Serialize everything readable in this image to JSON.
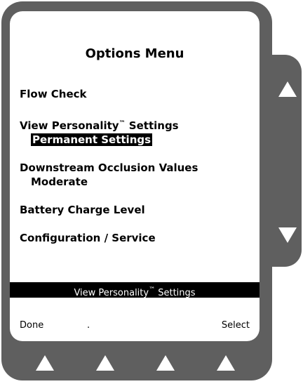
{
  "screen": {
    "title": "Options Menu",
    "menu": [
      {
        "label": "Flow Check"
      },
      {
        "label": "View Personality",
        "superscript": "™",
        "label_suffix": " Settings",
        "sub": "Permanent Settings",
        "sub_highlighted": true
      },
      {
        "label": "Downstream Occlusion Values",
        "sub": "Moderate"
      },
      {
        "label": "Battery Charge Level"
      },
      {
        "label": "Configuration / Service"
      }
    ],
    "status_bar": {
      "text": "View Personality",
      "superscript": "™",
      "suffix": " Settings"
    },
    "softkeys": {
      "left": "Done",
      "middle": ".",
      "right": "Select"
    }
  },
  "hardware": {
    "side_buttons": [
      "arrow-up-icon",
      "arrow-down-icon"
    ],
    "bottom_buttons": [
      "softkey-1-icon",
      "softkey-2-icon",
      "softkey-3-icon",
      "softkey-4-icon"
    ],
    "bezel_color": "#5f5f5f"
  }
}
